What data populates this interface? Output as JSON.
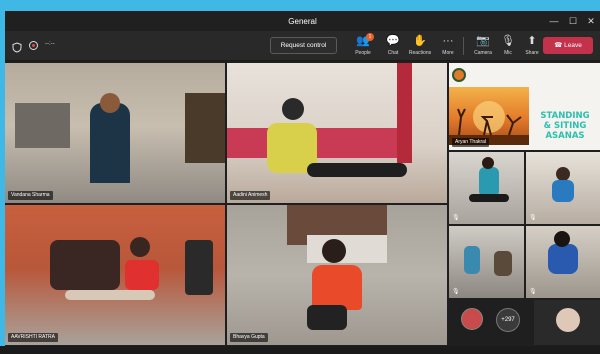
{
  "window": {
    "title": "General",
    "minimize": "—",
    "maximize": "☐",
    "close": "✕"
  },
  "toolbar": {
    "timer": "--:--",
    "request_control": "Request control",
    "people_label": "People",
    "people_count": "1",
    "chat_label": "Chat",
    "reactions_label": "Reactions",
    "more_label": "More",
    "camera_label": "Camera",
    "mic_label": "Mic",
    "share_label": "Share",
    "leave_label": "Leave"
  },
  "participants": [
    {
      "name": "Vandana Sharma"
    },
    {
      "name": "Aadini Animesh"
    },
    {
      "name": "AAVRISHTI RATRA"
    },
    {
      "name": "Bhavya Gupta"
    },
    {
      "name": "Aryan Thakral"
    }
  ],
  "banner": {
    "line1": "STANDING",
    "line2": "& SITING",
    "line3": "ASANAS"
  },
  "overflow_count": "+297",
  "colors": {
    "accent": "#5b5fc7",
    "leave": "#c4314b",
    "banner_text": "#2bbfae"
  }
}
